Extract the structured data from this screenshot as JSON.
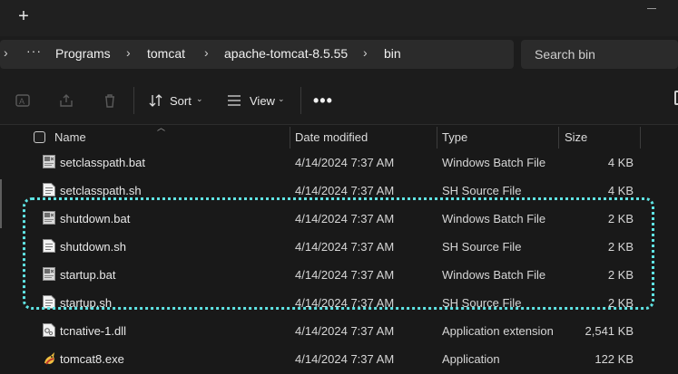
{
  "titlebar": {
    "new_tab_glyph": "+"
  },
  "address": {
    "more_glyph": "···",
    "crumbs": [
      "Programs",
      "tomcat",
      "apache-tomcat-8.5.55",
      "bin"
    ],
    "search_placeholder": "Search bin"
  },
  "toolbar": {
    "sort_label": "Sort",
    "view_label": "View",
    "more_label": "•••"
  },
  "columns": {
    "name": "Name",
    "date": "Date modified",
    "type": "Type",
    "size": "Size"
  },
  "files": [
    {
      "name": "setclasspath.bat",
      "date": "4/14/2024 7:37 AM",
      "type": "Windows Batch File",
      "size": "4 KB",
      "icon": "batch-file-icon"
    },
    {
      "name": "setclasspath.sh",
      "date": "4/14/2024 7:37 AM",
      "type": "SH Source File",
      "size": "4 KB",
      "icon": "sh-file-icon"
    },
    {
      "name": "shutdown.bat",
      "date": "4/14/2024 7:37 AM",
      "type": "Windows Batch File",
      "size": "2 KB",
      "icon": "batch-file-icon"
    },
    {
      "name": "shutdown.sh",
      "date": "4/14/2024 7:37 AM",
      "type": "SH Source File",
      "size": "2 KB",
      "icon": "sh-file-icon"
    },
    {
      "name": "startup.bat",
      "date": "4/14/2024 7:37 AM",
      "type": "Windows Batch File",
      "size": "2 KB",
      "icon": "batch-file-icon"
    },
    {
      "name": "startup.sh",
      "date": "4/14/2024 7:37 AM",
      "type": "SH Source File",
      "size": "2 KB",
      "icon": "sh-file-icon"
    },
    {
      "name": "tcnative-1.dll",
      "date": "4/14/2024 7:37 AM",
      "type": "Application extension",
      "size": "2,541 KB",
      "icon": "dll-file-icon"
    },
    {
      "name": "tomcat8.exe",
      "date": "4/14/2024 7:37 AM",
      "type": "Application",
      "size": "122 KB",
      "icon": "tomcat-exe-icon"
    }
  ],
  "colors": {
    "highlight": "#5fe3e3",
    "background": "#191919"
  }
}
